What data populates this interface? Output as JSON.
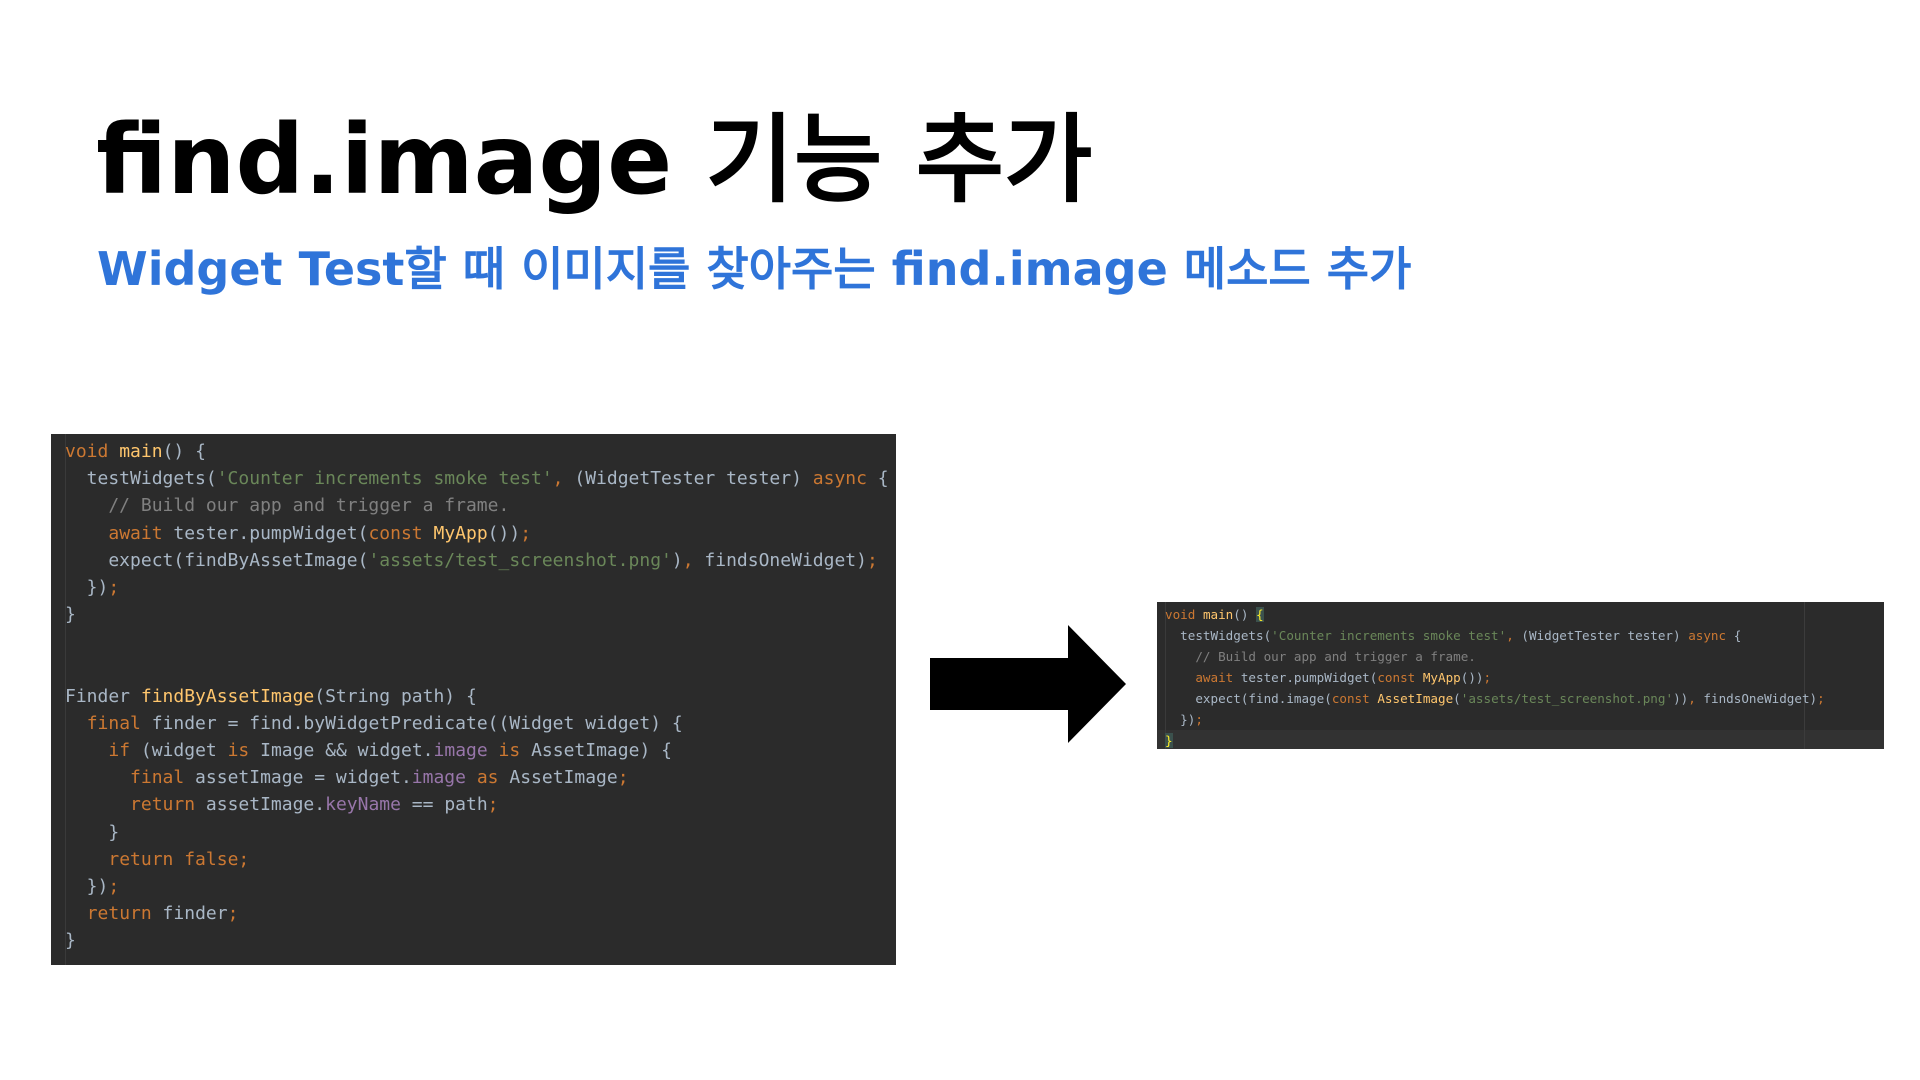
{
  "slide": {
    "title": "find.image 기능 추가",
    "subtitle": "Widget Test할 때 이미지를 찾아주는 find.image 메소드 추가"
  },
  "colors": {
    "title": "#000000",
    "subtitle": "#2f74d9",
    "editor_background": "#2b2b2b",
    "keyword": "#cc7832",
    "function": "#ffc66d",
    "string": "#6a8759",
    "comment": "#808080",
    "property": "#9876aa",
    "plain": "#a9b7c6"
  },
  "icons": {
    "arrow": "right-arrow-icon"
  },
  "before_code": {
    "lines": [
      [
        {
          "t": "void",
          "c": "kw"
        },
        {
          "t": " "
        },
        {
          "t": "main",
          "c": "fn"
        },
        {
          "t": "() {"
        }
      ],
      [
        {
          "t": "  testWidgets("
        },
        {
          "t": "'Counter increments smoke test'",
          "c": "str"
        },
        {
          "t": ", ",
          "c": "kw"
        },
        {
          "t": "(WidgetTester tester) "
        },
        {
          "t": "async",
          "c": "kw"
        },
        {
          "t": " {"
        }
      ],
      [
        {
          "t": "    // Build our app and trigger a frame.",
          "c": "cm"
        }
      ],
      [
        {
          "t": "    "
        },
        {
          "t": "await",
          "c": "kw"
        },
        {
          "t": " tester.pumpWidget("
        },
        {
          "t": "const",
          "c": "kw"
        },
        {
          "t": " "
        },
        {
          "t": "MyApp",
          "c": "fn"
        },
        {
          "t": "())"
        },
        {
          "t": ";",
          "c": "kw"
        }
      ],
      [
        {
          "t": "    expect(findByAssetImage("
        },
        {
          "t": "'assets/test_screenshot.png'",
          "c": "str"
        },
        {
          "t": ")"
        },
        {
          "t": ", ",
          "c": "kw"
        },
        {
          "t": "findsOneWidget)"
        },
        {
          "t": ";",
          "c": "kw"
        }
      ],
      [
        {
          "t": "  })"
        },
        {
          "t": ";",
          "c": "kw"
        }
      ],
      [
        {
          "t": "}"
        }
      ],
      [
        {
          "t": ""
        }
      ],
      [
        {
          "t": ""
        }
      ],
      [
        {
          "t": "Finder "
        },
        {
          "t": "findByAssetImage",
          "c": "fn"
        },
        {
          "t": "(String path) {"
        }
      ],
      [
        {
          "t": "  "
        },
        {
          "t": "final",
          "c": "kw"
        },
        {
          "t": " finder = find.byWidgetPredicate((Widget widget) {"
        }
      ],
      [
        {
          "t": "    "
        },
        {
          "t": "if",
          "c": "kw"
        },
        {
          "t": " (widget "
        },
        {
          "t": "is",
          "c": "kw"
        },
        {
          "t": " Image && widget."
        },
        {
          "t": "image",
          "c": "prop"
        },
        {
          "t": " "
        },
        {
          "t": "is",
          "c": "kw"
        },
        {
          "t": " AssetImage) {"
        }
      ],
      [
        {
          "t": "      "
        },
        {
          "t": "final",
          "c": "kw"
        },
        {
          "t": " assetImage = widget."
        },
        {
          "t": "image",
          "c": "prop"
        },
        {
          "t": " "
        },
        {
          "t": "as",
          "c": "kw"
        },
        {
          "t": " AssetImage"
        },
        {
          "t": ";",
          "c": "kw"
        }
      ],
      [
        {
          "t": "      "
        },
        {
          "t": "return",
          "c": "kw"
        },
        {
          "t": " assetImage."
        },
        {
          "t": "keyName",
          "c": "prop"
        },
        {
          "t": " == path"
        },
        {
          "t": ";",
          "c": "kw"
        }
      ],
      [
        {
          "t": "    }"
        }
      ],
      [
        {
          "t": "    "
        },
        {
          "t": "return false;",
          "c": "kw"
        }
      ],
      [
        {
          "t": "  })"
        },
        {
          "t": ";",
          "c": "kw"
        }
      ],
      [
        {
          "t": "  "
        },
        {
          "t": "return",
          "c": "kw"
        },
        {
          "t": " finder"
        },
        {
          "t": ";",
          "c": "kw"
        }
      ],
      [
        {
          "t": "}"
        }
      ]
    ]
  },
  "after_code": {
    "lines": [
      [
        {
          "t": "void",
          "c": "kw"
        },
        {
          "t": " "
        },
        {
          "t": "main",
          "c": "fn"
        },
        {
          "t": "() "
        },
        {
          "t": "{",
          "c": "hl"
        }
      ],
      [
        {
          "t": "  testWidgets("
        },
        {
          "t": "'Counter increments smoke test'",
          "c": "str"
        },
        {
          "t": ", ",
          "c": "kw"
        },
        {
          "t": "(WidgetTester tester) "
        },
        {
          "t": "async",
          "c": "kw"
        },
        {
          "t": " {"
        }
      ],
      [
        {
          "t": "    // Build our app and trigger a frame.",
          "c": "cm"
        }
      ],
      [
        {
          "t": "    "
        },
        {
          "t": "await",
          "c": "kw"
        },
        {
          "t": " tester.pumpWidget("
        },
        {
          "t": "const",
          "c": "kw"
        },
        {
          "t": " "
        },
        {
          "t": "MyApp",
          "c": "fn"
        },
        {
          "t": "())"
        },
        {
          "t": ";",
          "c": "kw"
        }
      ],
      [
        {
          "t": "    expect(find.image("
        },
        {
          "t": "const",
          "c": "kw"
        },
        {
          "t": " "
        },
        {
          "t": "AssetImage",
          "c": "fn"
        },
        {
          "t": "("
        },
        {
          "t": "'assets/test_screenshot.png'",
          "c": "str"
        },
        {
          "t": "))"
        },
        {
          "t": ", ",
          "c": "kw"
        },
        {
          "t": "findsOneWidget)"
        },
        {
          "t": ";",
          "c": "kw"
        }
      ],
      [
        {
          "t": "  })"
        },
        {
          "t": ";",
          "c": "kw"
        }
      ],
      [
        {
          "t": "}",
          "c": "hl"
        }
      ]
    ]
  }
}
